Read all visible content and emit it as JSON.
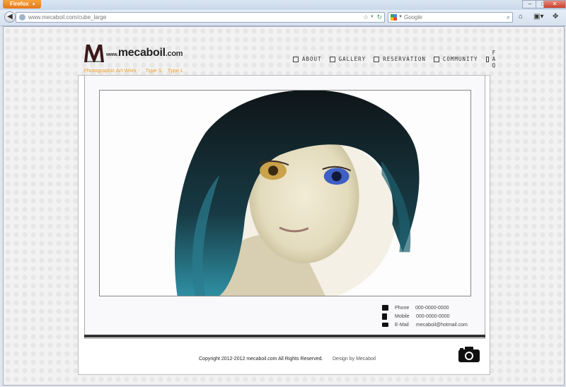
{
  "browser": {
    "app_button": "Firefox",
    "url_host": "www.mecaboil.com",
    "url_path": "/cube_large",
    "search_placeholder": "Google"
  },
  "site": {
    "logo_www": "www.",
    "logo_name": "mecaboil",
    "logo_tld": ".com",
    "nav": [
      "ABOUT",
      "GALLERY",
      "RESERVATION",
      "COMMUNITY",
      "F A Q"
    ],
    "subnav": {
      "category": "Photographic Art Work -",
      "type_s": "Type S",
      "type_l": "Type L"
    },
    "contact": [
      {
        "icon": "phone-icon",
        "label": "Phone",
        "value": "000-0000-0000"
      },
      {
        "icon": "mobile-icon",
        "label": "Mobile",
        "value": "000-0000-0000"
      },
      {
        "icon": "mail-icon",
        "label": "E-Mail",
        "value": "mecaboil@hotmail.com"
      }
    ],
    "copyright": "Copyright 2012-2012 mecaboil.com All Rights Reserved.",
    "design_credit": "Design by Mecaboil"
  },
  "colors": {
    "accent_orange": "#e89e2a",
    "firefox_orange": "#e4791a"
  }
}
